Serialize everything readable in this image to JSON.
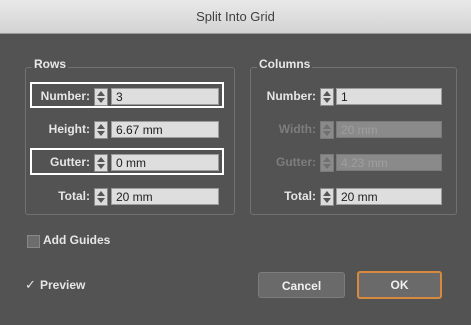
{
  "dialog": {
    "title": "Split Into Grid"
  },
  "rows": {
    "legend": "Rows",
    "number_label": "Number:",
    "number_value": "3",
    "height_label": "Height:",
    "height_value": "6.67 mm",
    "gutter_label": "Gutter:",
    "gutter_value": "0 mm",
    "total_label": "Total:",
    "total_value": "20 mm"
  },
  "columns": {
    "legend": "Columns",
    "number_label": "Number:",
    "number_value": "1",
    "width_label": "Width:",
    "width_value": "20 mm",
    "gutter_label": "Gutter:",
    "gutter_value": "4.23 mm",
    "total_label": "Total:",
    "total_value": "20 mm"
  },
  "options": {
    "add_guides_label": "Add Guides",
    "add_guides_checked": false,
    "preview_label": "Preview",
    "preview_checked": true
  },
  "buttons": {
    "cancel_label": "Cancel",
    "ok_label": "OK"
  },
  "colors": {
    "dialog_bg": "#535353",
    "ok_border": "#d78a3d",
    "highlight": "#ffffff"
  },
  "icons": {
    "checkmark": "✓"
  }
}
